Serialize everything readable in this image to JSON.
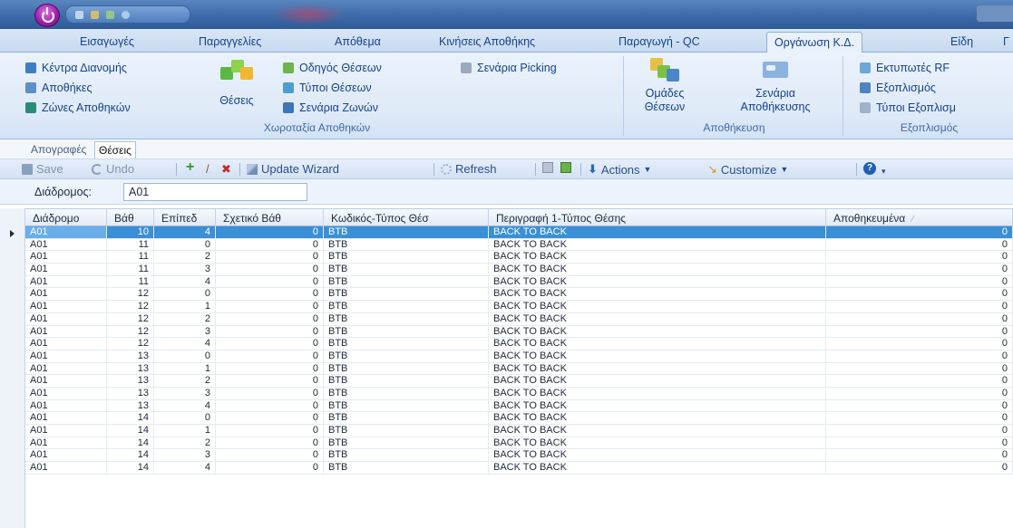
{
  "ribbon_tabs": [
    "Εισαγωγές",
    "Παραγγελίες",
    "Απόθεμα",
    "Κινήσεις Αποθήκης",
    "Παραγωγή - QC",
    "Οργάνωση Κ.Δ.",
    "Είδη",
    "Γ"
  ],
  "active_tab": "Οργάνωση Κ.Δ.",
  "ribbon": {
    "group1": {
      "items": [
        "Κέντρα Διανομής",
        "Αποθήκες",
        "Ζώνες Αποθηκών"
      ],
      "big_label": "Θέσεις",
      "items2": [
        "Οδηγός Θέσεων",
        "Τύποι Θέσεων",
        "Σενάρια Ζωνών"
      ],
      "item3": "Σενάρια Picking",
      "label": "Χωροταξία Αποθηκών"
    },
    "group2": {
      "big1_line1": "Ομάδες",
      "big1_line2": "Θέσεων",
      "big2_line1": "Σενάρια",
      "big2_line2": "Αποθήκευσης",
      "label": "Αποθήκευση"
    },
    "group3": {
      "items": [
        "Εκτυπωτές RF",
        "Εξοπλισμός",
        "Τύποι Εξοπλισμ"
      ],
      "label": "Εξοπλισμός"
    }
  },
  "sub_tabs": [
    "Απογραφές",
    "Θέσεις"
  ],
  "active_sub_tab": "Θέσεις",
  "toolbar": {
    "save": "Save",
    "undo": "Undo",
    "update_wizard": "Update Wizard",
    "refresh": "Refresh",
    "actions": "Actions",
    "customize": "Customize"
  },
  "filter": {
    "label": "Διάδρομος:",
    "value": "A01"
  },
  "grid": {
    "columns": [
      "Διάδρομο",
      "Βάθ",
      "Επίπεδ",
      "Σχετικό Βάθ",
      "Κωδικός-Τύπος Θέσ",
      "Περιγραφή 1-Τύπος Θέσης",
      "Αποθηκευμένα"
    ],
    "rows": [
      [
        "A01",
        "10",
        "4",
        "0",
        "BTB",
        "BACK TO BACK",
        "0"
      ],
      [
        "A01",
        "11",
        "0",
        "0",
        "BTB",
        "BACK TO BACK",
        "0"
      ],
      [
        "A01",
        "11",
        "2",
        "0",
        "BTB",
        "BACK TO BACK",
        "0"
      ],
      [
        "A01",
        "11",
        "3",
        "0",
        "BTB",
        "BACK TO BACK",
        "0"
      ],
      [
        "A01",
        "11",
        "4",
        "0",
        "BTB",
        "BACK TO BACK",
        "0"
      ],
      [
        "A01",
        "12",
        "0",
        "0",
        "BTB",
        "BACK TO BACK",
        "0"
      ],
      [
        "A01",
        "12",
        "1",
        "0",
        "BTB",
        "BACK TO BACK",
        "0"
      ],
      [
        "A01",
        "12",
        "2",
        "0",
        "BTB",
        "BACK TO BACK",
        "0"
      ],
      [
        "A01",
        "12",
        "3",
        "0",
        "BTB",
        "BACK TO BACK",
        "0"
      ],
      [
        "A01",
        "12",
        "4",
        "0",
        "BTB",
        "BACK TO BACK",
        "0"
      ],
      [
        "A01",
        "13",
        "0",
        "0",
        "BTB",
        "BACK TO BACK",
        "0"
      ],
      [
        "A01",
        "13",
        "1",
        "0",
        "BTB",
        "BACK TO BACK",
        "0"
      ],
      [
        "A01",
        "13",
        "2",
        "0",
        "BTB",
        "BACK TO BACK",
        "0"
      ],
      [
        "A01",
        "13",
        "3",
        "0",
        "BTB",
        "BACK TO BACK",
        "0"
      ],
      [
        "A01",
        "13",
        "4",
        "0",
        "BTB",
        "BACK TO BACK",
        "0"
      ],
      [
        "A01",
        "14",
        "0",
        "0",
        "BTB",
        "BACK TO BACK",
        "0"
      ],
      [
        "A01",
        "14",
        "1",
        "0",
        "BTB",
        "BACK TO BACK",
        "0"
      ],
      [
        "A01",
        "14",
        "2",
        "0",
        "BTB",
        "BACK TO BACK",
        "0"
      ],
      [
        "A01",
        "14",
        "3",
        "0",
        "BTB",
        "BACK TO BACK",
        "0"
      ],
      [
        "A01",
        "14",
        "4",
        "0",
        "BTB",
        "BACK TO BACK",
        "0"
      ]
    ],
    "selected_row": 0
  },
  "colors": {
    "ribbon_text": "#15428b",
    "selection": "#3a8fd6",
    "save_icon": "#2b6ab0",
    "add_icon": "#2e9a2e",
    "delete_icon": "#c62828",
    "help_icon": "#1f5fb0"
  },
  "icons": {
    "app": "power-orb-icon",
    "save": "floppy-disk-icon",
    "undo": "undo-arrow-icon",
    "add": "plus-icon",
    "edit": "pencil-icon",
    "delete": "x-delete-icon",
    "wizard": "wand-icon",
    "refresh": "refresh-gear-icon",
    "print": "printer-icon",
    "excel": "spreadsheet-icon",
    "actions": "down-arrow-icon",
    "customize": "customize-brush-icon",
    "help": "help-icon"
  }
}
